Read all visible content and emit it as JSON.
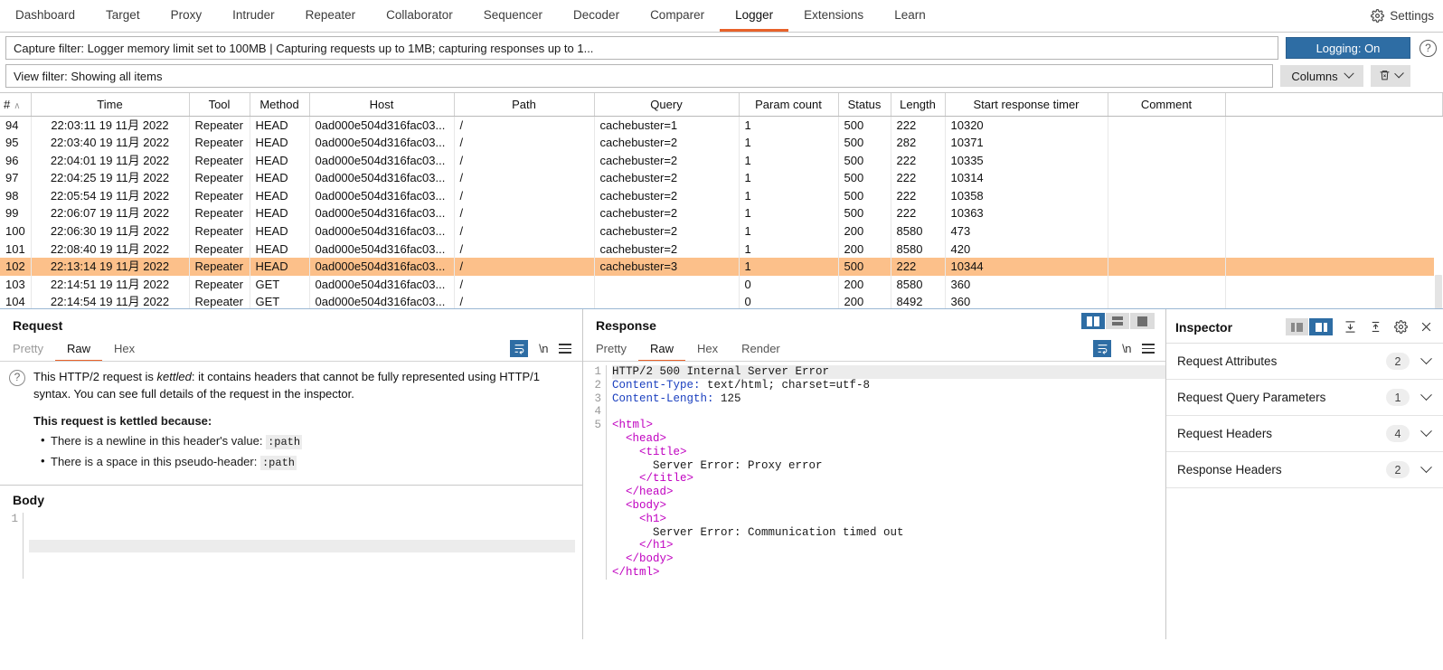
{
  "topbar": {
    "tabs": [
      {
        "label": "Dashboard",
        "active": false
      },
      {
        "label": "Target",
        "active": false
      },
      {
        "label": "Proxy",
        "active": false
      },
      {
        "label": "Intruder",
        "active": false
      },
      {
        "label": "Repeater",
        "active": false
      },
      {
        "label": "Collaborator",
        "active": false
      },
      {
        "label": "Sequencer",
        "active": false
      },
      {
        "label": "Decoder",
        "active": false
      },
      {
        "label": "Comparer",
        "active": false
      },
      {
        "label": "Logger",
        "active": true
      },
      {
        "label": "Extensions",
        "active": false
      },
      {
        "label": "Learn",
        "active": false
      }
    ],
    "settings_label": "Settings",
    "settings_icon": "gear-icon"
  },
  "filters": {
    "capture_filter": "Capture filter: Logger memory limit set to 100MB | Capturing requests up to 1MB;  capturing responses up to 1...",
    "view_filter": "View filter: Showing all items",
    "logging_button": "Logging: On",
    "help_icon": "question-mark-icon",
    "columns_button": "Columns",
    "trash_icon": "trash-can-icon",
    "chevron_icon": "chevron-down-icon"
  },
  "table": {
    "columns": [
      {
        "key": "idx",
        "label": "#",
        "sorted": true,
        "sort_arrow": "∧"
      },
      {
        "key": "time",
        "label": "Time"
      },
      {
        "key": "tool",
        "label": "Tool"
      },
      {
        "key": "method",
        "label": "Method"
      },
      {
        "key": "host",
        "label": "Host"
      },
      {
        "key": "path",
        "label": "Path"
      },
      {
        "key": "query",
        "label": "Query"
      },
      {
        "key": "param_count",
        "label": "Param count"
      },
      {
        "key": "status",
        "label": "Status"
      },
      {
        "key": "length",
        "label": "Length"
      },
      {
        "key": "timer",
        "label": "Start response timer"
      },
      {
        "key": "comment",
        "label": "Comment"
      },
      {
        "key": "blank",
        "label": ""
      }
    ],
    "rows": [
      {
        "idx": "94",
        "time": "22:03:11 19 11月 2022",
        "tool": "Repeater",
        "method": "HEAD",
        "host": "0ad000e504d316fac03...",
        "path": "/",
        "query": "cachebuster=1",
        "param_count": "1",
        "status": "500",
        "length": "222",
        "timer": "10320",
        "comment": "",
        "highlight": false
      },
      {
        "idx": "95",
        "time": "22:03:40 19 11月 2022",
        "tool": "Repeater",
        "method": "HEAD",
        "host": "0ad000e504d316fac03...",
        "path": "/",
        "query": "cachebuster=2",
        "param_count": "1",
        "status": "500",
        "length": "282",
        "timer": "10371",
        "comment": "",
        "highlight": false
      },
      {
        "idx": "96",
        "time": "22:04:01 19 11月 2022",
        "tool": "Repeater",
        "method": "HEAD",
        "host": "0ad000e504d316fac03...",
        "path": "/",
        "query": "cachebuster=2",
        "param_count": "1",
        "status": "500",
        "length": "222",
        "timer": "10335",
        "comment": "",
        "highlight": false
      },
      {
        "idx": "97",
        "time": "22:04:25 19 11月 2022",
        "tool": "Repeater",
        "method": "HEAD",
        "host": "0ad000e504d316fac03...",
        "path": "/",
        "query": "cachebuster=2",
        "param_count": "1",
        "status": "500",
        "length": "222",
        "timer": "10314",
        "comment": "",
        "highlight": false
      },
      {
        "idx": "98",
        "time": "22:05:54 19 11月 2022",
        "tool": "Repeater",
        "method": "HEAD",
        "host": "0ad000e504d316fac03...",
        "path": "/",
        "query": "cachebuster=2",
        "param_count": "1",
        "status": "500",
        "length": "222",
        "timer": "10358",
        "comment": "",
        "highlight": false
      },
      {
        "idx": "99",
        "time": "22:06:07 19 11月 2022",
        "tool": "Repeater",
        "method": "HEAD",
        "host": "0ad000e504d316fac03...",
        "path": "/",
        "query": "cachebuster=2",
        "param_count": "1",
        "status": "500",
        "length": "222",
        "timer": "10363",
        "comment": "",
        "highlight": false
      },
      {
        "idx": "100",
        "time": "22:06:30 19 11月 2022",
        "tool": "Repeater",
        "method": "HEAD",
        "host": "0ad000e504d316fac03...",
        "path": "/",
        "query": "cachebuster=2",
        "param_count": "1",
        "status": "200",
        "length": "8580",
        "timer": "473",
        "comment": "",
        "highlight": false
      },
      {
        "idx": "101",
        "time": "22:08:40 19 11月 2022",
        "tool": "Repeater",
        "method": "HEAD",
        "host": "0ad000e504d316fac03...",
        "path": "/",
        "query": "cachebuster=2",
        "param_count": "1",
        "status": "200",
        "length": "8580",
        "timer": "420",
        "comment": "",
        "highlight": false
      },
      {
        "idx": "102",
        "time": "22:13:14 19 11月 2022",
        "tool": "Repeater",
        "method": "HEAD",
        "host": "0ad000e504d316fac03...",
        "path": "/",
        "query": "cachebuster=3",
        "param_count": "1",
        "status": "500",
        "length": "222",
        "timer": "10344",
        "comment": "",
        "highlight": true
      },
      {
        "idx": "103",
        "time": "22:14:51 19 11月 2022",
        "tool": "Repeater",
        "method": "GET",
        "host": "0ad000e504d316fac03...",
        "path": "/",
        "query": "",
        "param_count": "0",
        "status": "200",
        "length": "8580",
        "timer": "360",
        "comment": "",
        "highlight": false
      },
      {
        "idx": "104",
        "time": "22:14:54 19 11月 2022",
        "tool": "Repeater",
        "method": "GET",
        "host": "0ad000e504d316fac03...",
        "path": "/",
        "query": "",
        "param_count": "0",
        "status": "200",
        "length": "8492",
        "timer": "360",
        "comment": "",
        "highlight": false
      }
    ]
  },
  "request": {
    "title": "Request",
    "tabs": [
      {
        "label": "Pretty",
        "active": false,
        "muted": true
      },
      {
        "label": "Raw",
        "active": true,
        "muted": false
      },
      {
        "label": "Hex",
        "active": false,
        "muted": false
      }
    ],
    "icons": {
      "wrap": "word-wrap-icon",
      "newline": "\\n",
      "menu": "hamburger-menu-icon",
      "help": "question-mark-icon"
    },
    "notice_part1": "This HTTP/2 request is ",
    "notice_italic": "kettled",
    "notice_part2": ": it contains headers that cannot be fully represented using HTTP/1 syntax. You can see full details of the request in the inspector.",
    "reason_heading": "This request is kettled because:",
    "reasons": [
      {
        "text": "There is a newline in this header's value: ",
        "code": ":path"
      },
      {
        "text": "There is a space in this pseudo-header: ",
        "code": ":path"
      }
    ],
    "body_title": "Body",
    "body_gutter": [
      "1"
    ]
  },
  "response": {
    "title": "Response",
    "tabs": [
      {
        "label": "Pretty",
        "active": false,
        "muted": false
      },
      {
        "label": "Raw",
        "active": true,
        "muted": false
      },
      {
        "label": "Hex",
        "active": false,
        "muted": false
      },
      {
        "label": "Render",
        "active": false,
        "muted": false
      }
    ],
    "icons": {
      "wrap": "word-wrap-icon",
      "newline": "\\n",
      "menu": "hamburger-menu-icon"
    },
    "view_toggle": [
      {
        "name": "split-vertical-view-icon",
        "active": true
      },
      {
        "name": "stacked-rows-view-icon",
        "active": false
      },
      {
        "name": "single-pane-view-icon",
        "active": false
      }
    ],
    "gutter": [
      "1",
      "2",
      "3",
      "4",
      "5"
    ],
    "lines": [
      {
        "type": "status",
        "text": "HTTP/2 500 Internal Server Error"
      },
      {
        "type": "header",
        "name": "Content-Type:",
        "value": " text/html; charset=utf-8"
      },
      {
        "type": "header",
        "name": "Content-Length:",
        "value": " 125"
      },
      {
        "type": "blank",
        "text": ""
      },
      {
        "type": "tag",
        "indent": 0,
        "text": "<html>"
      },
      {
        "type": "tag",
        "indent": 2,
        "text": "<head>"
      },
      {
        "type": "tag",
        "indent": 4,
        "text": "<title>"
      },
      {
        "type": "text",
        "indent": 6,
        "text": "Server Error: Proxy error"
      },
      {
        "type": "tag",
        "indent": 4,
        "text": "</title>"
      },
      {
        "type": "tag",
        "indent": 2,
        "text": "</head>"
      },
      {
        "type": "tag",
        "indent": 2,
        "text": "<body>"
      },
      {
        "type": "tag",
        "indent": 4,
        "text": "<h1>"
      },
      {
        "type": "text",
        "indent": 6,
        "text": "Server Error: Communication timed out"
      },
      {
        "type": "tag",
        "indent": 4,
        "text": "</h1>"
      },
      {
        "type": "tag",
        "indent": 2,
        "text": "</body>"
      },
      {
        "type": "tag",
        "indent": 0,
        "text": "</html>"
      }
    ]
  },
  "inspector": {
    "title": "Inspector",
    "toggle": [
      {
        "name": "inspector-narrow-view-icon",
        "active": false
      },
      {
        "name": "inspector-wide-view-icon",
        "active": true
      }
    ],
    "icons": {
      "expand_all": "expand-all-icon",
      "collapse_all": "collapse-all-icon",
      "settings": "gear-icon",
      "close": "close-icon"
    },
    "sections": [
      {
        "label": "Request Attributes",
        "count": "2"
      },
      {
        "label": "Request Query Parameters",
        "count": "1"
      },
      {
        "label": "Request Headers",
        "count": "4"
      },
      {
        "label": "Response Headers",
        "count": "2"
      }
    ]
  },
  "colors": {
    "accent": "#e8622a",
    "blue": "#2e6da4",
    "highlight_row": "#fcc08a",
    "annotation": "#f61f1f"
  }
}
